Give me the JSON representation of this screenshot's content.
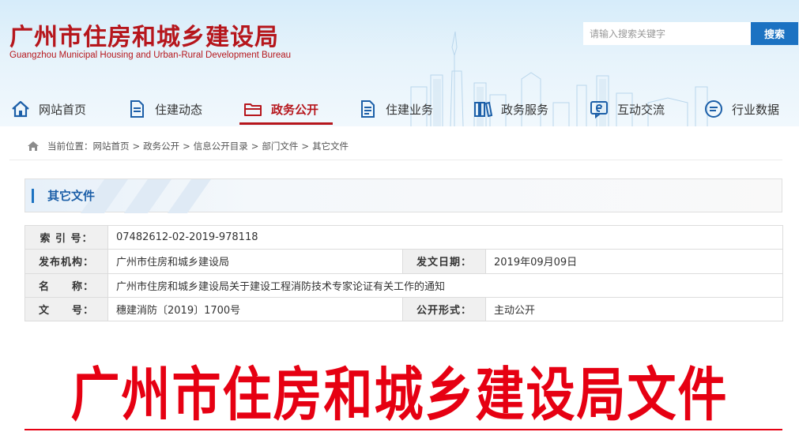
{
  "header": {
    "title": "广州市住房和城乡建设局",
    "subtitle": "Guangzhou Municipal Housing and Urban-Rural Development Bureau",
    "search_placeholder": "请输入搜索关键字",
    "search_button": "搜索"
  },
  "nav": {
    "items": [
      {
        "label": "网站首页",
        "icon": "home-icon"
      },
      {
        "label": "住建动态",
        "icon": "document-icon"
      },
      {
        "label": "政务公开",
        "icon": "folder-icon",
        "active": true
      },
      {
        "label": "住建业务",
        "icon": "document-list-icon"
      },
      {
        "label": "政务服务",
        "icon": "books-icon"
      },
      {
        "label": "互动交流",
        "icon": "e-chat-icon"
      },
      {
        "label": "行业数据",
        "icon": "chat-bubble-icon"
      }
    ]
  },
  "breadcrumb": {
    "prefix": "当前位置：",
    "items": [
      "网站首页",
      "政务公开",
      "信息公开目录",
      "部门文件",
      "其它文件"
    ],
    "separator": ">"
  },
  "section": {
    "title": "其它文件"
  },
  "info": {
    "index_label": "索 引 号：",
    "index_value": "07482612-02-2019-978118",
    "publisher_label": "发布机构：",
    "publisher_value": "广州市住房和城乡建设局",
    "date_label": "发文日期：",
    "date_value": "2019年09月09日",
    "name_label": "名　　称：",
    "name_value": "广州市住房和城乡建设局关于建设工程消防技术专家论证有关工作的通知",
    "docno_label": "文　　号：",
    "docno_value": "穗建消防〔2019〕1700号",
    "form_label": "公开形式：",
    "form_value": "主动公开"
  },
  "document": {
    "header_title": "广州市住房和城乡建设局文件"
  },
  "colors": {
    "brand_red": "#b6161c",
    "doc_red": "#e60012",
    "accent_blue": "#1c72c2"
  }
}
